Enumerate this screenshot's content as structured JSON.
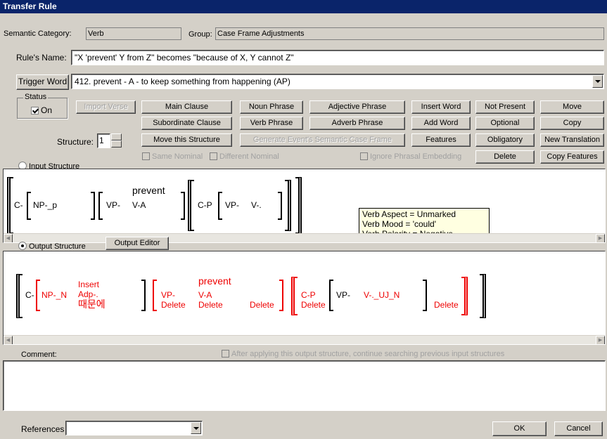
{
  "window": {
    "title": "Transfer Rule"
  },
  "header": {
    "semantic_category_label": "Semantic Category:",
    "semantic_category_value": "Verb",
    "group_label": "Group:",
    "group_value": "Case Frame Adjustments"
  },
  "rule": {
    "name_label": "Rule's Name:",
    "name_value": "\"X 'prevent' Y from Z\" becomes \"because of X, Y cannot Z\""
  },
  "trigger": {
    "button_label": "Trigger Word",
    "value": "412. prevent - A - to keep something from happening (AP)"
  },
  "status": {
    "group_label": "Status",
    "on_label": "On",
    "on_checked": true
  },
  "import_verse_label": "Import Verse",
  "structure": {
    "label": "Structure:",
    "value": "1"
  },
  "buttons": {
    "main_clause": "Main Clause",
    "subordinate_clause": "Subordinate Clause",
    "move_this_structure": "Move this Structure",
    "noun_phrase": "Noun Phrase",
    "verb_phrase": "Verb Phrase",
    "adjective_phrase": "Adjective Phrase",
    "adverb_phrase": "Adverb Phrase",
    "generate_case_frame": "Generate Event's Semantic Case Frame",
    "insert_word": "Insert Word",
    "add_word": "Add Word",
    "features": "Features",
    "not_present": "Not Present",
    "optional": "Optional",
    "obligatory": "Obligatory",
    "delete": "Delete",
    "move": "Move",
    "copy": "Copy",
    "new_translation": "New Translation",
    "copy_features": "Copy Features"
  },
  "checks": {
    "same_nominal": "Same Nominal",
    "different_nominal": "Different Nominal",
    "ignore_phrasal": "Ignore Phrasal Embedding",
    "after_applying": "After applying this output structure, continue searching previous input structures"
  },
  "input": {
    "radio_label": "Input Structure",
    "c": "C-",
    "np": "NP-_p",
    "vp": "VP-",
    "verb_word": "prevent",
    "va": "V-A",
    "cp": "C-P",
    "vp2": "VP-",
    "v2": "V-."
  },
  "tooltip": {
    "line1": "Verb Aspect = Unmarked",
    "line2": "Verb Mood = 'could'",
    "line3": "Verb Polarity = Negative"
  },
  "output": {
    "radio_label": "Output Structure",
    "editor_button": "Output Editor",
    "c": "C-",
    "np": "NP-_N",
    "insert": "Insert",
    "adp": "Adp-.",
    "korean": "때문에",
    "vp": "VP-",
    "delete": "Delete",
    "verb_word": "prevent",
    "va": "V-A",
    "cp": "C-P",
    "vp2": "VP-",
    "v2": "V-._UJ_N"
  },
  "comment": {
    "label": "Comment:"
  },
  "references": {
    "label": "References"
  },
  "footer": {
    "ok": "OK",
    "cancel": "Cancel"
  }
}
